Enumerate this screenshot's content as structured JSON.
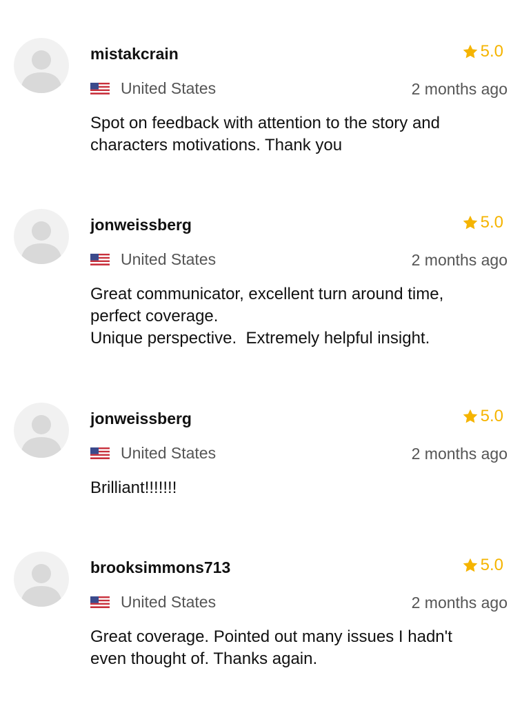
{
  "colors": {
    "star": "#f5b400",
    "avatar_bg": "#f1f1f1",
    "avatar_fg": "#d9d9d9",
    "muted_text": "#555555"
  },
  "icons": {
    "avatar": "default-user-avatar-icon",
    "star": "star-icon",
    "flag": "us-flag-icon"
  },
  "reviews": [
    {
      "username": "mistakcrain",
      "rating": "5.0",
      "country": "United States",
      "time": "2 months ago",
      "comment_lines": [
        "Spot on feedback with attention to the story and",
        "characters motivations. Thank you"
      ]
    },
    {
      "username": "jonweissberg",
      "rating": "5.0",
      "country": "United States",
      "time": "2 months ago",
      "comment_lines": [
        "Great communicator, excellent turn around time,",
        "perfect coverage.",
        "Unique perspective.  Extremely helpful insight."
      ]
    },
    {
      "username": "jonweissberg",
      "rating": "5.0",
      "country": "United States",
      "time": "2 months ago",
      "comment_lines": [
        "Brilliant!!!!!!!"
      ]
    },
    {
      "username": "brooksimmons713",
      "rating": "5.0",
      "country": "United States",
      "time": "2 months ago",
      "comment_lines": [
        "Great coverage. Pointed out many issues I hadn't",
        "even thought of. Thanks again."
      ]
    }
  ]
}
